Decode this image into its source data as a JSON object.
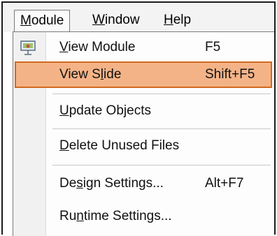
{
  "menubar": {
    "items": [
      {
        "label_pre": "",
        "accel": "M",
        "label_post": "odule"
      },
      {
        "label_pre": "",
        "accel": "W",
        "label_post": "indow"
      },
      {
        "label_pre": "",
        "accel": "H",
        "label_post": "elp"
      }
    ]
  },
  "menu": {
    "items": [
      {
        "pre": "",
        "accel": "V",
        "post": "iew Module",
        "shortcut": "F5",
        "icon": "presentation-icon"
      },
      {
        "pre": "View S",
        "accel": "l",
        "post": "ide",
        "shortcut": "Shift+F5",
        "highlighted": true
      },
      {
        "pre": "",
        "accel": "U",
        "post": "pdate Objects",
        "shortcut": ""
      },
      {
        "pre": "",
        "accel": "D",
        "post": "elete Unused Files",
        "shortcut": ""
      },
      {
        "pre": "De",
        "accel": "s",
        "post": "ign Settings...",
        "shortcut": "Alt+F7"
      },
      {
        "pre": "Ru",
        "accel": "n",
        "post": "time Settings...",
        "shortcut": ""
      }
    ]
  },
  "colors": {
    "highlight_fill": "#f4b387",
    "highlight_border": "#d2691e",
    "menubar_bg": "#f3f3f3",
    "gutter_bg": "#f1f1f1"
  }
}
